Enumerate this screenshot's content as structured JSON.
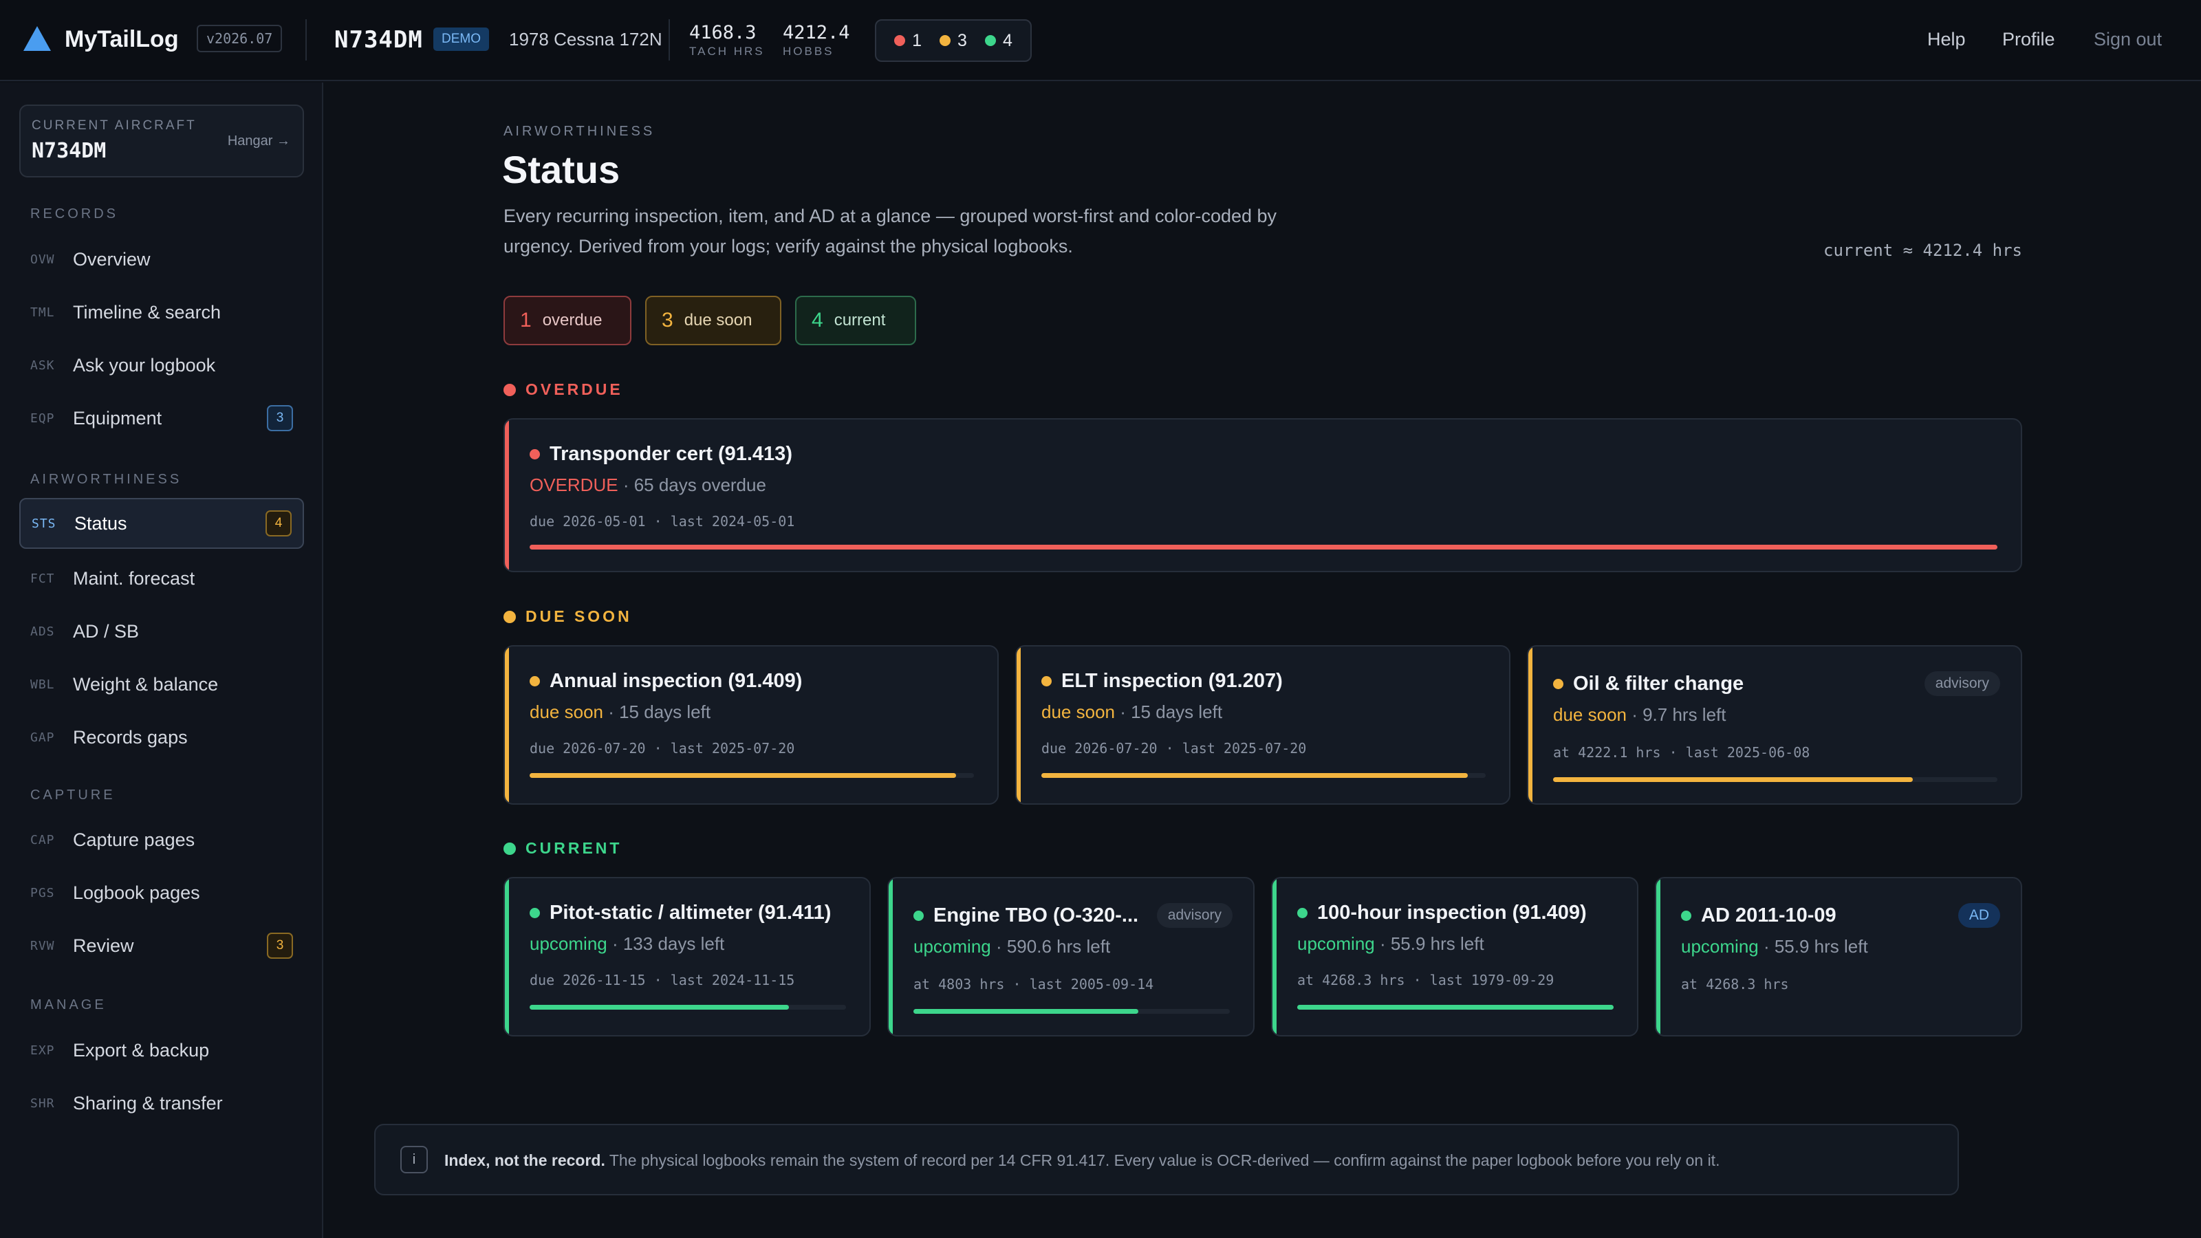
{
  "app": {
    "name": "MyTailLog",
    "version": "v2026.07"
  },
  "header": {
    "tail": "N734DM",
    "demo": "DEMO",
    "aircraft_model": "1978 Cessna 172N",
    "tach": {
      "value": "4168.3",
      "label": "TACH HRS"
    },
    "hobbs": {
      "value": "4212.4",
      "label": "HOBBS"
    },
    "counts": {
      "overdue": "1",
      "due_soon": "3",
      "current": "4"
    },
    "links": {
      "help": "Help",
      "profile": "Profile",
      "signout": "Sign out"
    }
  },
  "sidebar": {
    "current_label": "CURRENT AIRCRAFT",
    "current_value": "N734DM",
    "hangar_link": "Hangar →",
    "sections": {
      "records": "RECORDS",
      "airworthiness": "AIRWORTHINESS",
      "capture": "CAPTURE",
      "manage": "MANAGE"
    },
    "items": [
      {
        "code": "OVW",
        "label": "Overview"
      },
      {
        "code": "TML",
        "label": "Timeline & search"
      },
      {
        "code": "ASK",
        "label": "Ask your logbook"
      },
      {
        "code": "EQP",
        "label": "Equipment",
        "badge": "3"
      },
      {
        "code": "STS",
        "label": "Status",
        "badge": "4"
      },
      {
        "code": "FCT",
        "label": "Maint. forecast"
      },
      {
        "code": "ADS",
        "label": "AD / SB"
      },
      {
        "code": "WBL",
        "label": "Weight & balance"
      },
      {
        "code": "GAP",
        "label": "Records gaps"
      },
      {
        "code": "CAP",
        "label": "Capture pages"
      },
      {
        "code": "PGS",
        "label": "Logbook pages"
      },
      {
        "code": "RVW",
        "label": "Review",
        "badge": "3"
      },
      {
        "code": "EXP",
        "label": "Export & backup"
      },
      {
        "code": "SHR",
        "label": "Sharing & transfer"
      }
    ]
  },
  "main": {
    "breadcrumb": "AIRWORTHINESS",
    "title": "Status",
    "description": "Every recurring inspection, item, and AD at a glance — grouped worst-first and color-coded by urgency. Derived from your logs; verify against the physical logbooks.",
    "current_hours": "current ≈ 4212.4 hrs",
    "pills": {
      "overdue": {
        "n": "1",
        "label": "overdue"
      },
      "due_soon": {
        "n": "3",
        "label": "due soon"
      },
      "current": {
        "n": "4",
        "label": "current"
      }
    },
    "groups": {
      "overdue": "OVERDUE",
      "due_soon": "DUE SOON",
      "current": "CURRENT"
    },
    "overdue": [
      {
        "title": "Transponder cert (91.413)",
        "status": "OVERDUE",
        "sub": "· 65 days overdue",
        "meta": "due 2026-05-01 · last 2024-05-01",
        "progress": 1.0
      }
    ],
    "due_soon": [
      {
        "title": "Annual inspection (91.409)",
        "status": "due soon",
        "sub": "· 15 days left",
        "meta": "due 2026-07-20 · last 2025-07-20",
        "progress": 0.96
      },
      {
        "title": "ELT inspection (91.207)",
        "status": "due soon",
        "sub": "· 15 days left",
        "meta": "due 2026-07-20 · last 2025-07-20",
        "progress": 0.96
      },
      {
        "title": "Oil & filter change",
        "tag": "advisory",
        "status": "due soon",
        "sub": "· 9.7 hrs left",
        "meta": "at 4222.1 hrs · last 2025-06-08",
        "progress": 0.81
      }
    ],
    "current": [
      {
        "title": "Pitot-static / altimeter (91.411)",
        "status": "upcoming",
        "sub": "· 133 days left",
        "meta": "due 2026-11-15 · last 2024-11-15",
        "progress": 0.82
      },
      {
        "title": "Engine TBO (O-320-...",
        "tag": "advisory",
        "status": "upcoming",
        "sub": "· 590.6 hrs left",
        "meta": "at 4803 hrs · last 2005-09-14",
        "progress": 0.71
      },
      {
        "title": "100-hour inspection (91.409)",
        "status": "upcoming",
        "sub": "· 55.9 hrs left",
        "meta": "at 4268.3 hrs · last 1979-09-29",
        "progress": 1.0
      },
      {
        "title": "AD 2011-10-09",
        "tag": "AD",
        "status": "upcoming",
        "sub": "· 55.9 hrs left",
        "meta": "at 4268.3 hrs"
      }
    ],
    "notice": {
      "icon": "i",
      "bold": "Index, not the record.",
      "text": " The physical logbooks remain the system of record per 14 CFR 91.417. Every value is OCR-derived — confirm against the paper logbook before you rely on it."
    }
  },
  "colors": {
    "red": "#f0605a",
    "amber": "#f3b43f",
    "green": "#3dd68c",
    "blue": "#7ab8f5"
  }
}
